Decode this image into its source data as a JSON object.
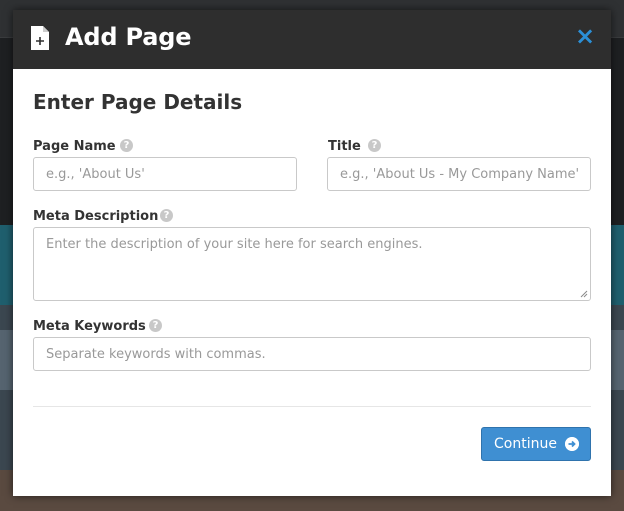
{
  "modal": {
    "title": "Add Page",
    "close_glyph": "×",
    "icons": {
      "header": "document-add-icon",
      "close": "close-icon",
      "help": "help-circle-icon",
      "continue": "arrow-circle-right-icon"
    },
    "section_title": "Enter Page Details",
    "fields": {
      "page_name": {
        "label": "Page Name",
        "placeholder": "e.g., 'About Us'"
      },
      "title": {
        "label": "Title",
        "placeholder": "e.g., 'About Us - My Company Name'"
      },
      "meta_description": {
        "label": "Meta Description",
        "placeholder": "Enter the description of your site here for search engines."
      },
      "meta_keywords": {
        "label": "Meta Keywords",
        "placeholder": "Separate keywords with commas."
      }
    },
    "help_glyph": "?",
    "continue_label": "Continue"
  },
  "colors": {
    "header_bg": "#2e2e2e",
    "accent": "#3f8fd2",
    "close": "#2b8fd6"
  }
}
